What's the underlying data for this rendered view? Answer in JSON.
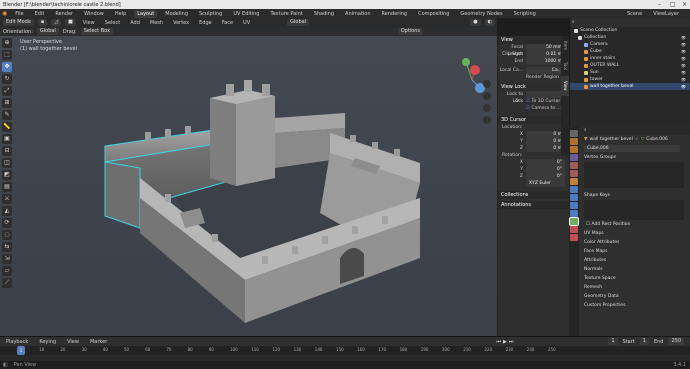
{
  "window": {
    "title": "Blender [F:\\blender\\tachiniorele castle 2.blend]"
  },
  "menu": [
    "File",
    "Edit",
    "Render",
    "Window",
    "Help"
  ],
  "workspaces": [
    "Layout",
    "Modeling",
    "Sculpting",
    "UV Editing",
    "Texture Paint",
    "Shading",
    "Animation",
    "Rendering",
    "Compositing",
    "Geometry Nodes",
    "Scripting"
  ],
  "active_workspace": "Layout",
  "scene_label": "Scene",
  "view_layer_label": "ViewLayer",
  "viewport": {
    "mode": "Edit Mode",
    "view_menus": [
      "View",
      "Select",
      "Add",
      "Mesh",
      "Vertex",
      "Edge",
      "Face",
      "UV"
    ],
    "orientation_label": "Orientation:",
    "orientation": "Global",
    "drag_label": "Drag:",
    "drag": "Select Box",
    "transform_pivot": "Global",
    "options": "Options",
    "perspective_label": "User Perspective",
    "object_label": "(1) wall together bevel",
    "tools": [
      "cursor",
      "select",
      "move",
      "rotate",
      "scale",
      "transform",
      "annotate",
      "measure",
      "add-cube",
      "extrude",
      "inset",
      "bevel",
      "loop-cut",
      "knife",
      "poly-build",
      "spin",
      "smooth",
      "edge-slide",
      "shrink",
      "shear",
      "rip"
    ]
  },
  "npanel": {
    "tabs": [
      "Item",
      "Tool",
      "View"
    ],
    "view_section": "View",
    "focal_length_label": "Focal Length",
    "focal_length": "50 mm",
    "clip_start_label": "Clip Start",
    "clip_start": "0.01 m",
    "clip_end_label": "End",
    "clip_end": "1000 m",
    "local_camera_label": "Local Ca...",
    "local_camera_value": "Ca...",
    "render_region": "Render Region",
    "view_lock": "View Lock",
    "lock_to_object": "Lock to O...",
    "lock_label": "Lock",
    "to_3d_cursor": "To 3D Cursor",
    "camera_to_view": "Camera to ...",
    "cursor_section": "3D Cursor",
    "location_label": "Location:",
    "loc_x_label": "X",
    "loc_x": "0 m",
    "loc_y_label": "Y",
    "loc_y": "0 m",
    "loc_z_label": "Z",
    "loc_z": "0 m",
    "rotation_label": "Rotation:",
    "rot_x_label": "X",
    "rot_x": "0°",
    "rot_y_label": "Y",
    "rot_y": "0°",
    "rot_z_label": "Z",
    "rot_z": "0°",
    "rotation_mode": "XYZ Euler",
    "collections_section": "Collections",
    "annotations_section": "Annotations"
  },
  "outliner": {
    "root": "Scene Collection",
    "items": [
      {
        "label": "Collection",
        "color": "#d6d6d6",
        "selected": false
      },
      {
        "label": "Camera",
        "color": "#9aa5ff",
        "selected": false
      },
      {
        "label": "Cube",
        "color": "#e49a3c",
        "selected": false
      },
      {
        "label": "inner stairs",
        "color": "#e49a3c",
        "selected": false
      },
      {
        "label": "OUTER WALL",
        "color": "#e49a3c",
        "selected": false
      },
      {
        "label": "Sun",
        "color": "#d8d070",
        "selected": false
      },
      {
        "label": "tower",
        "color": "#e49a3c",
        "selected": false
      },
      {
        "label": "wall together bevel",
        "color": "#e49a3c",
        "selected": true
      }
    ]
  },
  "properties": {
    "object_name": "wall together bevel",
    "mesh_name": "Cube.006",
    "mesh_field": "Cube.006",
    "vertex_groups": "Vertex Groups",
    "shape_keys": "Shape Keys",
    "add_rest_position": "Add Rest Position",
    "sections": [
      "UV Maps",
      "Color Attributes",
      "Face Maps",
      "Attributes",
      "Normals",
      "Texture Space",
      "Remesh",
      "Geometry Data",
      "Custom Properties"
    ]
  },
  "timeline": {
    "menus": [
      "Playback",
      "Keying",
      "View",
      "Marker"
    ],
    "current_frame": "1",
    "start_label": "Start",
    "start": "1",
    "end_label": "End",
    "end": "250",
    "ruler_ticks": [
      "0",
      "10",
      "20",
      "30",
      "40",
      "50",
      "60",
      "70",
      "80",
      "90",
      "100",
      "110",
      "120",
      "130",
      "140",
      "150",
      "160",
      "170",
      "180",
      "190",
      "200",
      "210",
      "220",
      "230",
      "240",
      "250"
    ]
  },
  "status": {
    "left": "Pan View",
    "version": "3.4.1"
  },
  "colors": {
    "accent": "#5680c2",
    "selection_outline": "#3fd3e0",
    "viewport_bg": "#41464e"
  }
}
